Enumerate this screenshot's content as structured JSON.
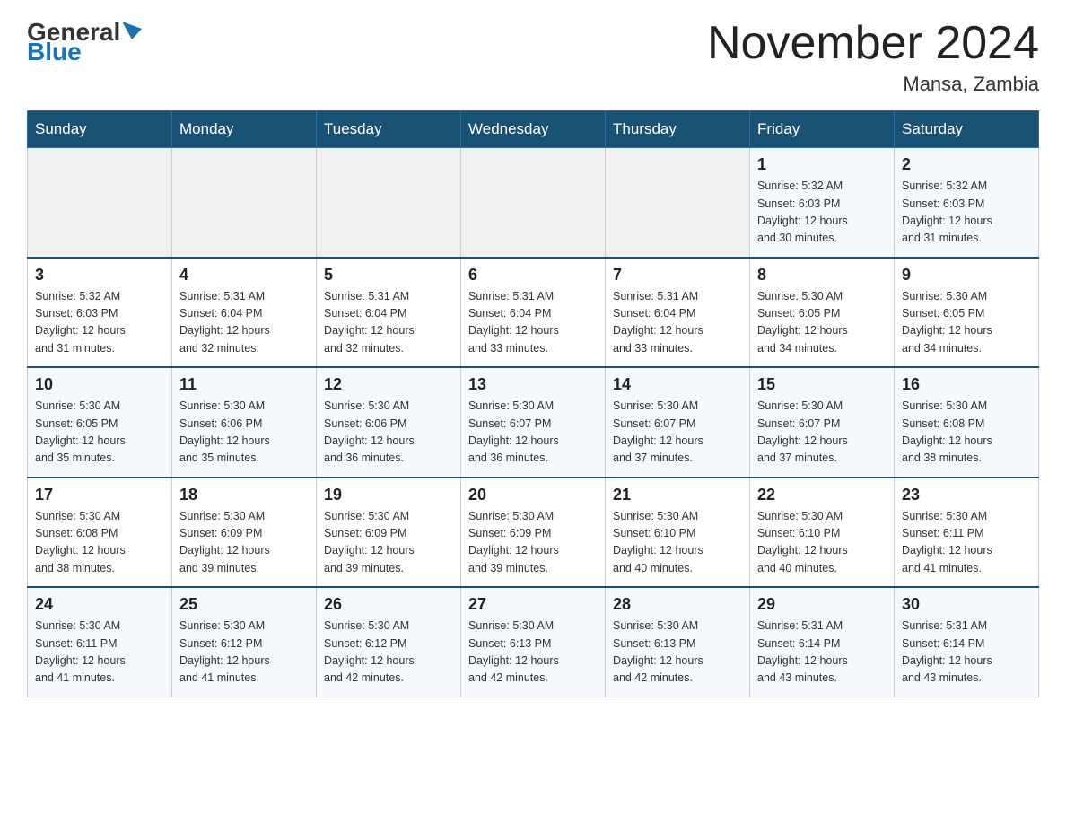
{
  "header": {
    "logo_general": "General",
    "logo_blue": "Blue",
    "title": "November 2024",
    "location": "Mansa, Zambia"
  },
  "weekdays": [
    "Sunday",
    "Monday",
    "Tuesday",
    "Wednesday",
    "Thursday",
    "Friday",
    "Saturday"
  ],
  "weeks": [
    [
      {
        "day": "",
        "info": ""
      },
      {
        "day": "",
        "info": ""
      },
      {
        "day": "",
        "info": ""
      },
      {
        "day": "",
        "info": ""
      },
      {
        "day": "",
        "info": ""
      },
      {
        "day": "1",
        "info": "Sunrise: 5:32 AM\nSunset: 6:03 PM\nDaylight: 12 hours\nand 30 minutes."
      },
      {
        "day": "2",
        "info": "Sunrise: 5:32 AM\nSunset: 6:03 PM\nDaylight: 12 hours\nand 31 minutes."
      }
    ],
    [
      {
        "day": "3",
        "info": "Sunrise: 5:32 AM\nSunset: 6:03 PM\nDaylight: 12 hours\nand 31 minutes."
      },
      {
        "day": "4",
        "info": "Sunrise: 5:31 AM\nSunset: 6:04 PM\nDaylight: 12 hours\nand 32 minutes."
      },
      {
        "day": "5",
        "info": "Sunrise: 5:31 AM\nSunset: 6:04 PM\nDaylight: 12 hours\nand 32 minutes."
      },
      {
        "day": "6",
        "info": "Sunrise: 5:31 AM\nSunset: 6:04 PM\nDaylight: 12 hours\nand 33 minutes."
      },
      {
        "day": "7",
        "info": "Sunrise: 5:31 AM\nSunset: 6:04 PM\nDaylight: 12 hours\nand 33 minutes."
      },
      {
        "day": "8",
        "info": "Sunrise: 5:30 AM\nSunset: 6:05 PM\nDaylight: 12 hours\nand 34 minutes."
      },
      {
        "day": "9",
        "info": "Sunrise: 5:30 AM\nSunset: 6:05 PM\nDaylight: 12 hours\nand 34 minutes."
      }
    ],
    [
      {
        "day": "10",
        "info": "Sunrise: 5:30 AM\nSunset: 6:05 PM\nDaylight: 12 hours\nand 35 minutes."
      },
      {
        "day": "11",
        "info": "Sunrise: 5:30 AM\nSunset: 6:06 PM\nDaylight: 12 hours\nand 35 minutes."
      },
      {
        "day": "12",
        "info": "Sunrise: 5:30 AM\nSunset: 6:06 PM\nDaylight: 12 hours\nand 36 minutes."
      },
      {
        "day": "13",
        "info": "Sunrise: 5:30 AM\nSunset: 6:07 PM\nDaylight: 12 hours\nand 36 minutes."
      },
      {
        "day": "14",
        "info": "Sunrise: 5:30 AM\nSunset: 6:07 PM\nDaylight: 12 hours\nand 37 minutes."
      },
      {
        "day": "15",
        "info": "Sunrise: 5:30 AM\nSunset: 6:07 PM\nDaylight: 12 hours\nand 37 minutes."
      },
      {
        "day": "16",
        "info": "Sunrise: 5:30 AM\nSunset: 6:08 PM\nDaylight: 12 hours\nand 38 minutes."
      }
    ],
    [
      {
        "day": "17",
        "info": "Sunrise: 5:30 AM\nSunset: 6:08 PM\nDaylight: 12 hours\nand 38 minutes."
      },
      {
        "day": "18",
        "info": "Sunrise: 5:30 AM\nSunset: 6:09 PM\nDaylight: 12 hours\nand 39 minutes."
      },
      {
        "day": "19",
        "info": "Sunrise: 5:30 AM\nSunset: 6:09 PM\nDaylight: 12 hours\nand 39 minutes."
      },
      {
        "day": "20",
        "info": "Sunrise: 5:30 AM\nSunset: 6:09 PM\nDaylight: 12 hours\nand 39 minutes."
      },
      {
        "day": "21",
        "info": "Sunrise: 5:30 AM\nSunset: 6:10 PM\nDaylight: 12 hours\nand 40 minutes."
      },
      {
        "day": "22",
        "info": "Sunrise: 5:30 AM\nSunset: 6:10 PM\nDaylight: 12 hours\nand 40 minutes."
      },
      {
        "day": "23",
        "info": "Sunrise: 5:30 AM\nSunset: 6:11 PM\nDaylight: 12 hours\nand 41 minutes."
      }
    ],
    [
      {
        "day": "24",
        "info": "Sunrise: 5:30 AM\nSunset: 6:11 PM\nDaylight: 12 hours\nand 41 minutes."
      },
      {
        "day": "25",
        "info": "Sunrise: 5:30 AM\nSunset: 6:12 PM\nDaylight: 12 hours\nand 41 minutes."
      },
      {
        "day": "26",
        "info": "Sunrise: 5:30 AM\nSunset: 6:12 PM\nDaylight: 12 hours\nand 42 minutes."
      },
      {
        "day": "27",
        "info": "Sunrise: 5:30 AM\nSunset: 6:13 PM\nDaylight: 12 hours\nand 42 minutes."
      },
      {
        "day": "28",
        "info": "Sunrise: 5:30 AM\nSunset: 6:13 PM\nDaylight: 12 hours\nand 42 minutes."
      },
      {
        "day": "29",
        "info": "Sunrise: 5:31 AM\nSunset: 6:14 PM\nDaylight: 12 hours\nand 43 minutes."
      },
      {
        "day": "30",
        "info": "Sunrise: 5:31 AM\nSunset: 6:14 PM\nDaylight: 12 hours\nand 43 minutes."
      }
    ]
  ]
}
